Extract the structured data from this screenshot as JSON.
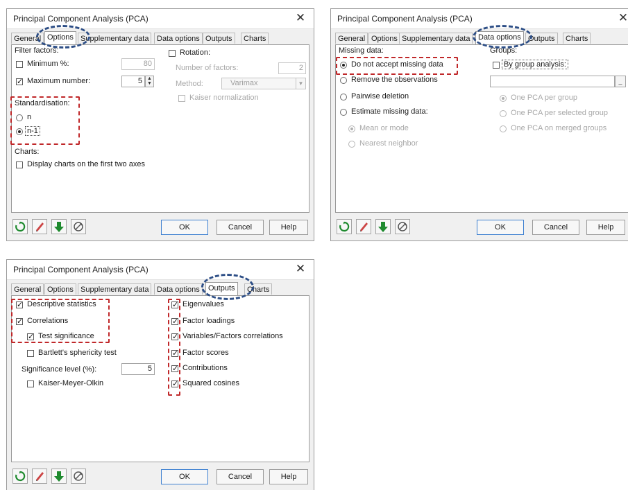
{
  "dialog_title": "Principal Component Analysis (PCA)",
  "close_glyph": "✕",
  "tabs": [
    "General",
    "Options",
    "Supplementary data",
    "Data options",
    "Outputs",
    "Charts"
  ],
  "footer": {
    "ok": "OK",
    "cancel": "Cancel",
    "help": "Help"
  },
  "options_dialog": {
    "active_tab": "Options",
    "filter_factors_label": "Filter factors:",
    "minimum_pct_label": "Minimum %:",
    "minimum_pct_checked": false,
    "minimum_pct_value": "80",
    "maximum_number_label": "Maximum number:",
    "maximum_number_checked": true,
    "maximum_number_value": "5",
    "rotation_label": "Rotation:",
    "rotation_checked": false,
    "number_of_factors_label": "Number of factors:",
    "number_of_factors_value": "2",
    "method_label": "Method:",
    "method_value": "Varimax",
    "kaiser_normalization_label": "Kaiser normalization",
    "standardisation_label": "Standardisation:",
    "std_n_label": "n",
    "std_n1_label": "n-1",
    "std_selected": "n-1",
    "charts_label": "Charts:",
    "display_charts_label": "Display charts on the first two axes"
  },
  "data_options_dialog": {
    "active_tab": "Data options",
    "missing_data_label": "Missing data:",
    "do_not_accept_label": "Do not accept missing data",
    "remove_observations_label": "Remove the observations",
    "pairwise_deletion_label": "Pairwise deletion",
    "estimate_missing_label": "Estimate missing data:",
    "mean_or_mode_label": "Mean or mode",
    "nearest_neighbor_label": "Nearest neighbor",
    "selected": "Do not accept missing data",
    "groups_label": "Groups:",
    "by_group_label": "By group analysis:",
    "by_group_checked": false,
    "one_pca_per_group": "One PCA per group",
    "one_pca_per_selected_group": "One PCA per selected group",
    "one_pca_merged": "One PCA on merged groups"
  },
  "outputs_dialog": {
    "active_tab": "Outputs",
    "descriptive_statistics_label": "Descriptive statistics",
    "correlations_label": "Correlations",
    "test_significance_label": "Test significance",
    "bartlett_label": "Bartlett's sphericity test",
    "significance_level_label": "Significance level (%):",
    "significance_level_value": "5",
    "kmo_label": "Kaiser-Meyer-Olkin",
    "eigenvalues_label": "Eigenvalues",
    "factor_loadings_label": "Factor loadings",
    "variables_factors_label": "Variables/Factors correlations",
    "factor_scores_label": "Factor scores",
    "contributions_label": "Contributions",
    "squared_cosines_label": "Squared cosines"
  },
  "check_glyph": "✓",
  "colors": {
    "highlight_red": "#c0282a",
    "highlight_blue": "#2d4e86",
    "dialog_bg": "#f0f0f0"
  },
  "icons": [
    "reset-icon",
    "eraser-icon",
    "download-icon",
    "cancel-selection-icon"
  ]
}
